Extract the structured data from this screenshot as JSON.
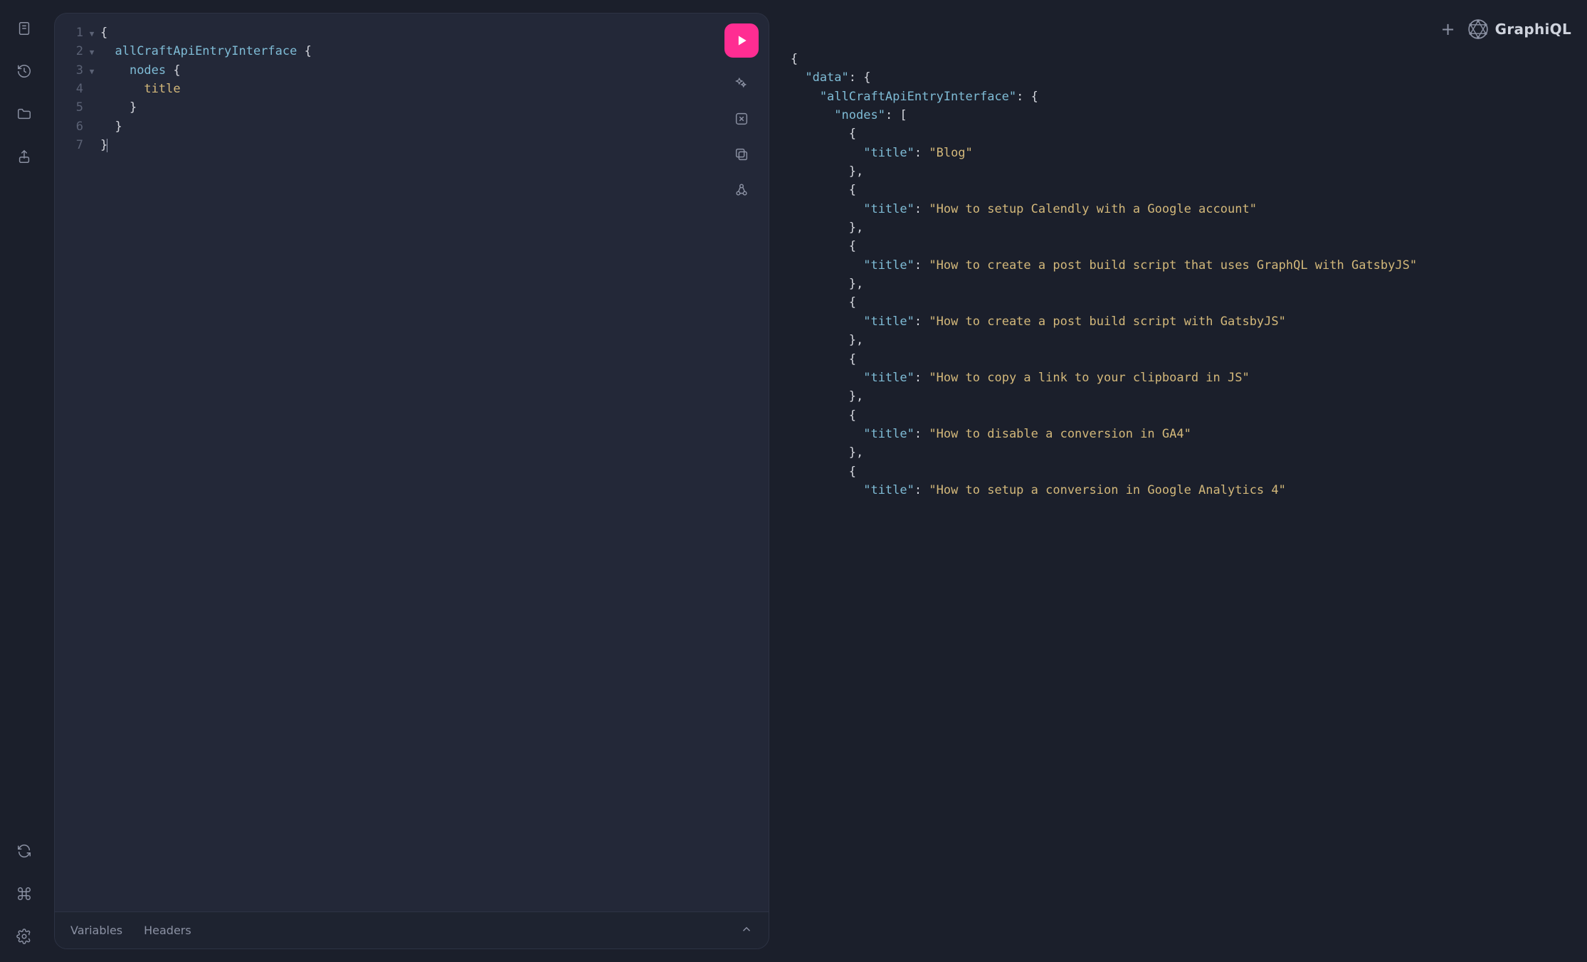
{
  "brand": {
    "name": "GraphiQL"
  },
  "rail": {
    "top": [
      {
        "name": "docs-icon"
      },
      {
        "name": "history-icon"
      },
      {
        "name": "explorer-folder-icon"
      },
      {
        "name": "share-icon"
      }
    ],
    "bottom": [
      {
        "name": "refresh-icon"
      },
      {
        "name": "shortcuts-icon"
      },
      {
        "name": "settings-icon"
      }
    ]
  },
  "editor": {
    "lines": [
      {
        "n": 1,
        "fold": true,
        "indent": 0,
        "tokens": [
          {
            "t": "{",
            "c": "brace"
          }
        ]
      },
      {
        "n": 2,
        "fold": true,
        "indent": 1,
        "tokens": [
          {
            "t": "allCraftApiEntryInterface",
            "c": "field"
          },
          {
            "t": " ",
            "c": "punc"
          },
          {
            "t": "{",
            "c": "brace"
          }
        ]
      },
      {
        "n": 3,
        "fold": true,
        "indent": 2,
        "tokens": [
          {
            "t": "nodes",
            "c": "field"
          },
          {
            "t": " ",
            "c": "punc"
          },
          {
            "t": "{",
            "c": "brace"
          }
        ]
      },
      {
        "n": 4,
        "fold": false,
        "indent": 3,
        "tokens": [
          {
            "t": "title",
            "c": "prop"
          }
        ]
      },
      {
        "n": 5,
        "fold": false,
        "indent": 2,
        "tokens": [
          {
            "t": "}",
            "c": "brace"
          }
        ]
      },
      {
        "n": 6,
        "fold": false,
        "indent": 1,
        "tokens": [
          {
            "t": "}",
            "c": "brace"
          }
        ]
      },
      {
        "n": 7,
        "fold": false,
        "indent": 0,
        "tokens": [
          {
            "t": "}",
            "c": "brace"
          }
        ],
        "cursor": true
      }
    ],
    "toolbar": {
      "run": "Execute query",
      "tools": [
        {
          "name": "prettify-icon"
        },
        {
          "name": "merge-icon"
        },
        {
          "name": "copy-icon"
        },
        {
          "name": "webhook-icon"
        }
      ]
    },
    "tabs": {
      "items": [
        {
          "label": "Variables"
        },
        {
          "label": "Headers"
        }
      ]
    }
  },
  "response": {
    "lines": [
      {
        "fold": true,
        "indent": 0,
        "tokens": [
          {
            "t": "{",
            "c": "brace"
          }
        ]
      },
      {
        "fold": true,
        "indent": 1,
        "tokens": [
          {
            "t": "\"data\"",
            "c": "key"
          },
          {
            "t": ": ",
            "c": "punc"
          },
          {
            "t": "{",
            "c": "brace"
          }
        ]
      },
      {
        "fold": true,
        "indent": 2,
        "tokens": [
          {
            "t": "\"allCraftApiEntryInterface\"",
            "c": "key"
          },
          {
            "t": ": ",
            "c": "punc"
          },
          {
            "t": "{",
            "c": "brace"
          }
        ]
      },
      {
        "fold": true,
        "indent": 3,
        "tokens": [
          {
            "t": "\"nodes\"",
            "c": "key"
          },
          {
            "t": ": ",
            "c": "punc"
          },
          {
            "t": "[",
            "c": "brace"
          }
        ]
      },
      {
        "fold": true,
        "indent": 4,
        "tokens": [
          {
            "t": "{",
            "c": "brace"
          }
        ]
      },
      {
        "fold": false,
        "indent": 5,
        "tokens": [
          {
            "t": "\"title\"",
            "c": "key"
          },
          {
            "t": ": ",
            "c": "punc"
          },
          {
            "t": "\"Blog\"",
            "c": "str"
          }
        ]
      },
      {
        "fold": false,
        "indent": 4,
        "tokens": [
          {
            "t": "},",
            "c": "brace"
          }
        ]
      },
      {
        "fold": true,
        "indent": 4,
        "tokens": [
          {
            "t": "{",
            "c": "brace"
          }
        ]
      },
      {
        "fold": false,
        "indent": 5,
        "tokens": [
          {
            "t": "\"title\"",
            "c": "key"
          },
          {
            "t": ": ",
            "c": "punc"
          },
          {
            "t": "\"How to setup Calendly with a Google account\"",
            "c": "str"
          }
        ]
      },
      {
        "fold": false,
        "indent": 4,
        "tokens": [
          {
            "t": "},",
            "c": "brace"
          }
        ]
      },
      {
        "fold": true,
        "indent": 4,
        "tokens": [
          {
            "t": "{",
            "c": "brace"
          }
        ]
      },
      {
        "fold": false,
        "indent": 5,
        "tokens": [
          {
            "t": "\"title\"",
            "c": "key"
          },
          {
            "t": ": ",
            "c": "punc"
          },
          {
            "t": "\"How to create a post build script that uses GraphQL with GatsbyJS\"",
            "c": "str"
          }
        ]
      },
      {
        "fold": false,
        "indent": 4,
        "tokens": [
          {
            "t": "},",
            "c": "brace"
          }
        ]
      },
      {
        "fold": true,
        "indent": 4,
        "tokens": [
          {
            "t": "{",
            "c": "brace"
          }
        ]
      },
      {
        "fold": false,
        "indent": 5,
        "tokens": [
          {
            "t": "\"title\"",
            "c": "key"
          },
          {
            "t": ": ",
            "c": "punc"
          },
          {
            "t": "\"How to create a post build script with GatsbyJS\"",
            "c": "str"
          }
        ]
      },
      {
        "fold": false,
        "indent": 4,
        "tokens": [
          {
            "t": "},",
            "c": "brace"
          }
        ]
      },
      {
        "fold": true,
        "indent": 4,
        "tokens": [
          {
            "t": "{",
            "c": "brace"
          }
        ]
      },
      {
        "fold": false,
        "indent": 5,
        "tokens": [
          {
            "t": "\"title\"",
            "c": "key"
          },
          {
            "t": ": ",
            "c": "punc"
          },
          {
            "t": "\"How to copy a link to your clipboard in JS\"",
            "c": "str"
          }
        ]
      },
      {
        "fold": false,
        "indent": 4,
        "tokens": [
          {
            "t": "},",
            "c": "brace"
          }
        ]
      },
      {
        "fold": true,
        "indent": 4,
        "tokens": [
          {
            "t": "{",
            "c": "brace"
          }
        ]
      },
      {
        "fold": false,
        "indent": 5,
        "tokens": [
          {
            "t": "\"title\"",
            "c": "key"
          },
          {
            "t": ": ",
            "c": "punc"
          },
          {
            "t": "\"How to disable a conversion in GA4\"",
            "c": "str"
          }
        ]
      },
      {
        "fold": false,
        "indent": 4,
        "tokens": [
          {
            "t": "},",
            "c": "brace"
          }
        ]
      },
      {
        "fold": true,
        "indent": 4,
        "tokens": [
          {
            "t": "{",
            "c": "brace"
          }
        ]
      },
      {
        "fold": false,
        "indent": 5,
        "tokens": [
          {
            "t": "\"title\"",
            "c": "key"
          },
          {
            "t": ": ",
            "c": "punc"
          },
          {
            "t": "\"How to setup a conversion in Google Analytics 4\"",
            "c": "str"
          }
        ]
      }
    ]
  }
}
